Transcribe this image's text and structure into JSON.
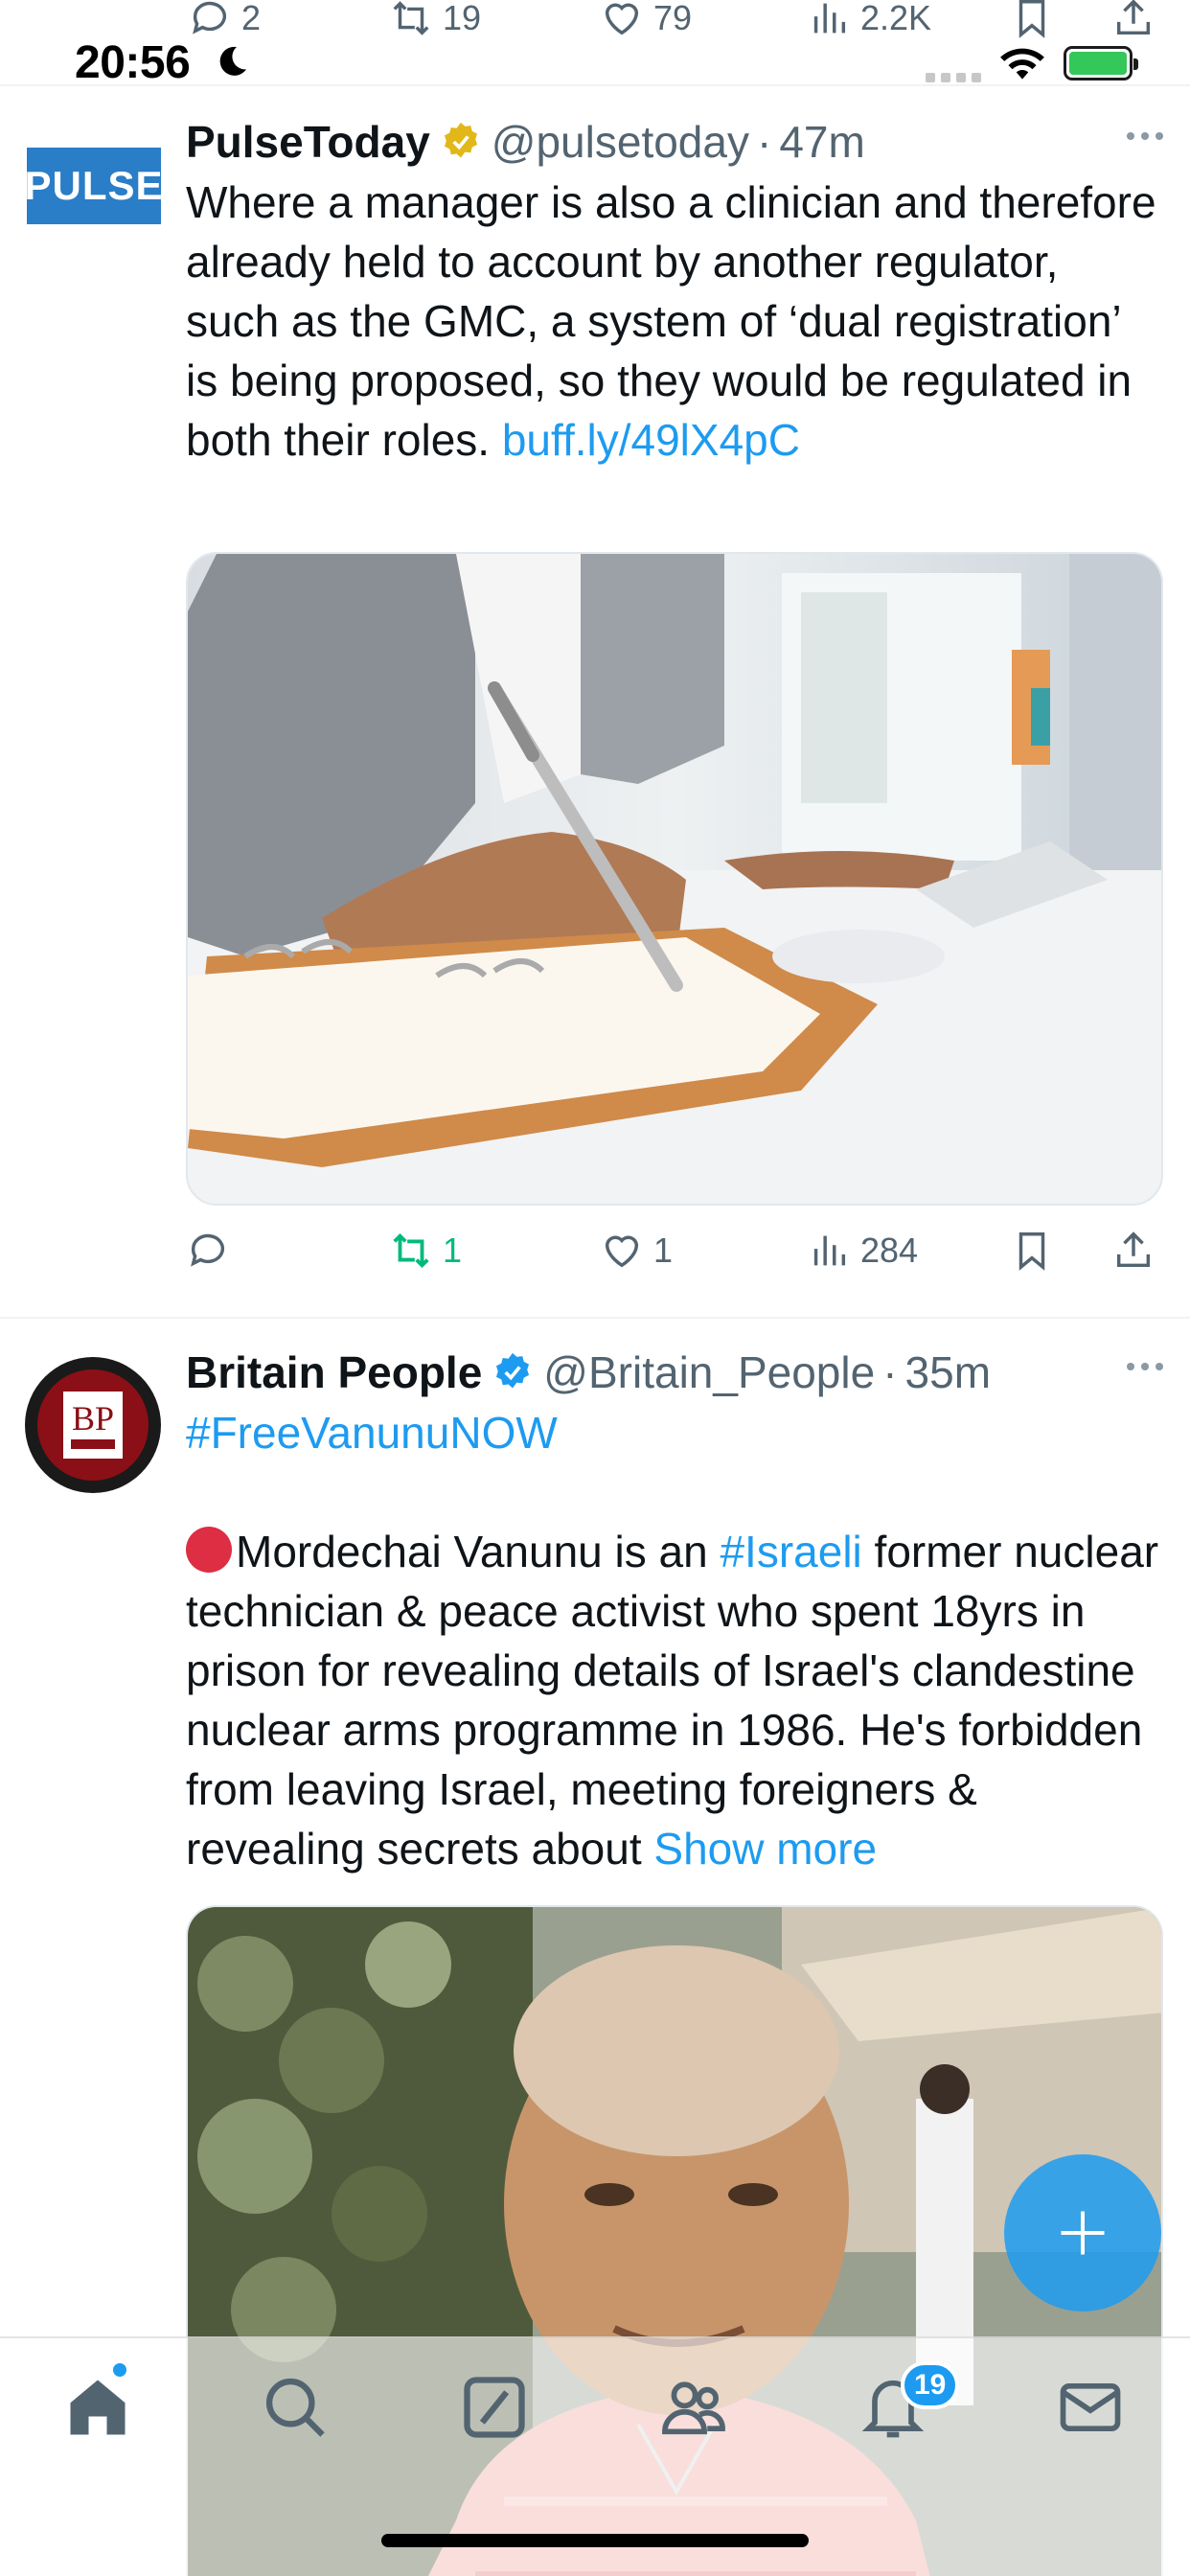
{
  "status_bar": {
    "time": "20:56"
  },
  "prev_tweet_actions": {
    "replies": "2",
    "reposts": "19",
    "likes": "79",
    "views": "2.2K"
  },
  "tweets": [
    {
      "name": "PulseToday",
      "handle": "@pulsetoday",
      "separator": "·",
      "time": "47m",
      "avatar_text": "PULSE",
      "text": "Where a manager is also a clinician and therefore already held to account by another regulator, such as the GMC, a system of ‘dual registration’ is being proposed, so they would be regulated in both their roles. ",
      "link": "buff.ly/​49lX4pC",
      "actions": {
        "replies": "",
        "reposts": "1",
        "likes": "1",
        "views": "284"
      }
    },
    {
      "name": "Britain People",
      "handle": "@Britain_People",
      "separator": "·",
      "time": "35m",
      "avatar_text": "BP",
      "hashtag_line": "#FreeVanunuNOW",
      "text_1": "Mordechai Vanunu is an ",
      "hashtag_inline": "#Israeli",
      "text_2": " former nuclear technician & peace activist who spent 18yrs in prison for revealing details of Israel's clandestine nuclear arms programme in 1986. He's forbidden from leaving Israel, meeting foreigners & revealing secrets about ",
      "show_more": "Show more"
    }
  ],
  "tabbar": {
    "notifications_badge": "19"
  },
  "colors": {
    "accent": "#1d9bf0",
    "repost_active": "#00ba7c",
    "secondary_text": "#536471"
  },
  "icons": [
    "reply-icon",
    "repost-icon",
    "like-icon",
    "views-icon",
    "bookmark-icon",
    "share-icon",
    "home-icon",
    "search-icon",
    "grok-icon",
    "communities-icon",
    "bell-icon",
    "mail-icon",
    "plus-icon"
  ]
}
